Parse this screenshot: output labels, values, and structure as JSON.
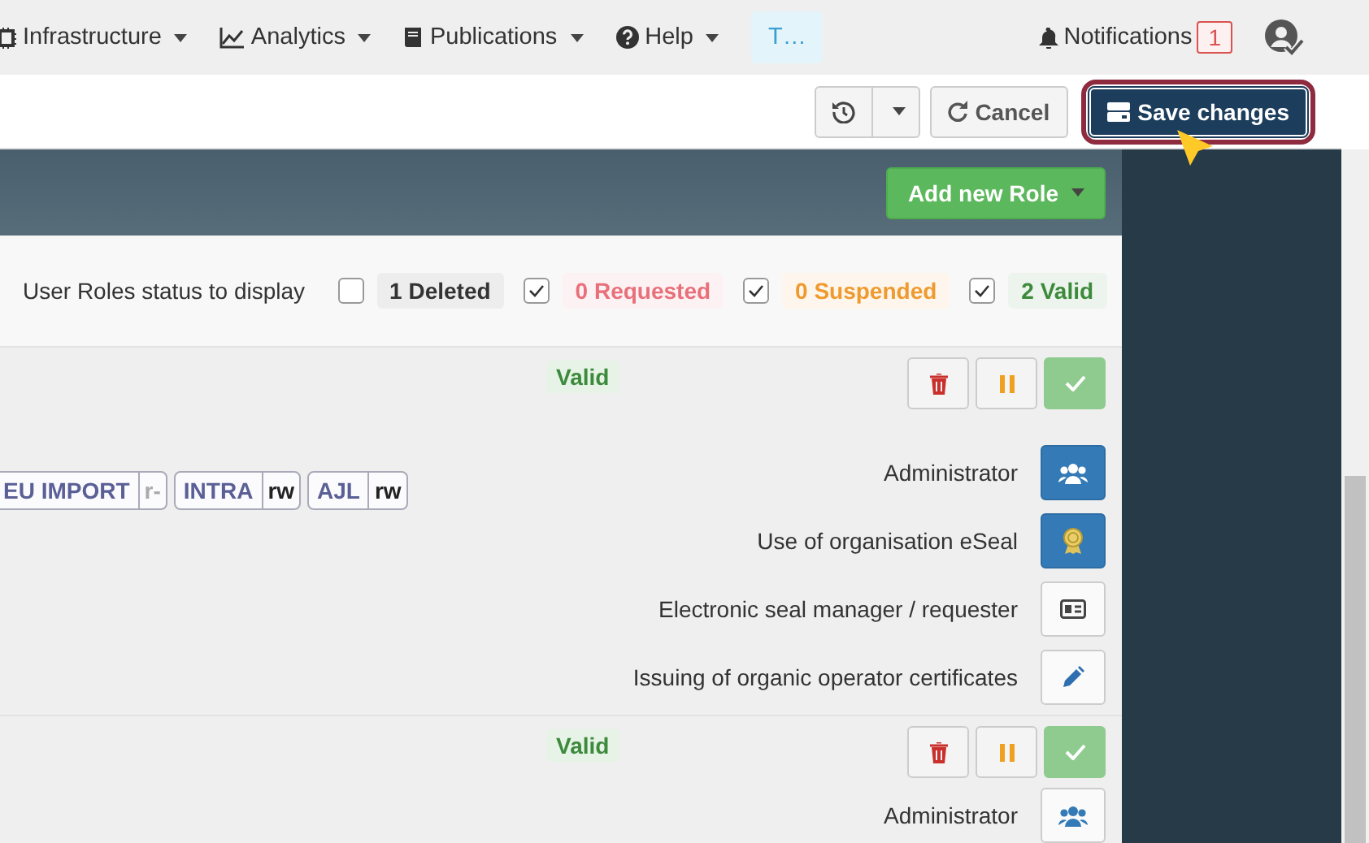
{
  "nav": {
    "items": [
      {
        "label": "Infrastructure"
      },
      {
        "label": "Analytics"
      },
      {
        "label": "Publications"
      },
      {
        "label": "Help"
      }
    ],
    "tab": {
      "label": "T…",
      "selected": true
    },
    "notifications": {
      "label": "Notifications",
      "count": "1"
    }
  },
  "toolbar": {
    "cancel": "Cancel",
    "save": "Save changes"
  },
  "header": {
    "add_button": "Add new Role"
  },
  "filter": {
    "label": "User Roles status to display",
    "options": [
      {
        "label": "1 Deleted",
        "checked": false,
        "color": "#333333"
      },
      {
        "label": "0 Requested",
        "checked": true,
        "color": "#e8707a"
      },
      {
        "label": "0 Suspended",
        "checked": true,
        "color": "#ef9a2e"
      },
      {
        "label": "2 Valid",
        "checked": true,
        "color": "#3c8a3c"
      }
    ]
  },
  "cards": [
    {
      "status": "Valid",
      "tags": [
        {
          "name": "EU IMPORT",
          "access": "r-",
          "muted": true
        },
        {
          "name": "INTRA",
          "access": "rw",
          "muted": false
        },
        {
          "name": "AJL",
          "access": "rw",
          "muted": false
        }
      ],
      "roles": [
        {
          "label": "Administrator",
          "active": true
        },
        {
          "label": "Use of organisation eSeal",
          "active": true
        },
        {
          "label": "Electronic seal manager / requester",
          "active": false
        },
        {
          "label": "Issuing of organic operator certificates",
          "active": false
        }
      ]
    },
    {
      "status": "Valid",
      "roles": [
        {
          "label": "Administrator",
          "active": false
        }
      ]
    }
  ]
}
